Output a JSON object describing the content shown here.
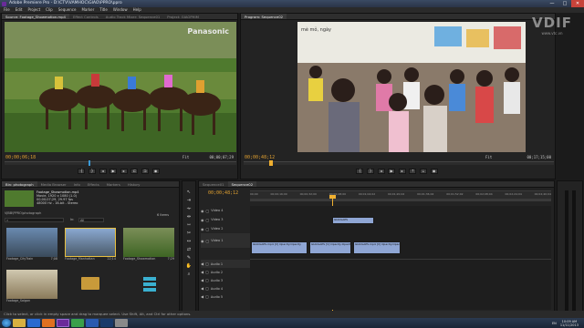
{
  "window": {
    "title": "Adobe Premiere Pro - D:\\CTV\\VAMHOC\\GIAO\\PPRO\\ppro",
    "buttons": [
      "—",
      "□",
      "✕"
    ]
  },
  "menu": [
    "File",
    "Edit",
    "Project",
    "Clip",
    "Sequence",
    "Marker",
    "Title",
    "Window",
    "Help"
  ],
  "source_monitor": {
    "tabs": [
      "Source: Footage_Showmotion.mp4",
      "Effect Controls",
      "Audio Track Mixer: Sequence01",
      "Project: GIAOPHIM"
    ],
    "timecode": "00;00;06;18",
    "duration": "00;00;07;29",
    "zoom": "Fit",
    "overlay_brand": "Panasonic"
  },
  "program_monitor": {
    "tabs": [
      "Program: Sequence02"
    ],
    "timecode": "00;00;48;12",
    "duration": "00;17;15;00",
    "zoom": "Fit",
    "overlay_text": "mè mỏ, ngày"
  },
  "project_panel": {
    "tabs": [
      "Bin: photograph",
      "Media Browser",
      "Info",
      "Effects",
      "Markers",
      "History"
    ],
    "preview": {
      "filename": "Footage_Showmotion.mp4",
      "line1": "Movie, 1920 x 1080 (1.0)",
      "line2": "00;00;07;29, 29.97 fps",
      "line3": "48000 Hz - 16-bit - Stereo"
    },
    "path": "VJBB\\PPRO\\photograph",
    "search_label": "In:",
    "search_value": "All",
    "items_count": "6 Items",
    "items": [
      {
        "name": "Footage_CityTrain",
        "duration": "7;08"
      },
      {
        "name": "Footage_Manhattan",
        "duration": "22;14"
      },
      {
        "name": "Footage_Showmotion",
        "duration": "7;29"
      },
      {
        "name": "Footage_Saigon",
        "duration": ""
      },
      {
        "name": "",
        "duration": ""
      },
      {
        "name": "",
        "duration": ""
      }
    ]
  },
  "timeline": {
    "tabs": [
      "Sequence01",
      "Sequence02"
    ],
    "timecode": "00;00;48;12",
    "ruler_labels": [
      "00;00",
      "00;00;16;00",
      "00;00;32;00",
      "00;00;48;00",
      "00;01;04;02",
      "00;01;20;02",
      "00;01;36;02",
      "00;01;52;02",
      "00;02;08;04",
      "00;02;24;04",
      "00;02;40;04"
    ],
    "video_tracks": [
      "Video 4",
      "Video 3",
      "Video 2",
      "Video 1"
    ],
    "audio_tracks": [
      "Audio 1",
      "Audio 2",
      "Audio 3",
      "Audio 4",
      "Audio 5"
    ],
    "clips": [
      {
        "track": "Video 3",
        "label": "GIAOLAPS",
        "kind": "video"
      },
      {
        "track": "Video 1",
        "label": "GIAOLAPS.mp4 [V] Opacity:Opacity",
        "kind": "video"
      },
      {
        "track": "Video 1",
        "label": "GIAOLAPS [V] Opacity:Opacity",
        "kind": "video"
      },
      {
        "track": "Video 1",
        "label": "GIAOLAPS.mp4 [V] Opacity:Opacity",
        "kind": "video"
      }
    ]
  },
  "status_bar": {
    "text": "Click to select, or click in empty space and drag to marquee select. Use Shift, Alt, and Ctrl for other options."
  },
  "taskbar": {
    "time": "10:09 AM",
    "date": "11/11/2013",
    "language": "EN",
    "apps": [
      "start",
      "explorer",
      "media",
      "firefox",
      "premiere",
      "chrome",
      "word",
      "photoshop",
      "other"
    ]
  },
  "watermark": {
    "text": "VDIF",
    "subtext": "www.vtc.vn"
  },
  "colors": {
    "accent_timecode": "#e0a030",
    "video_clip": "#8fa6d4",
    "audio_clip": "#7fb08a",
    "playhead": "#f0b030",
    "panel_bg": "#232323"
  }
}
